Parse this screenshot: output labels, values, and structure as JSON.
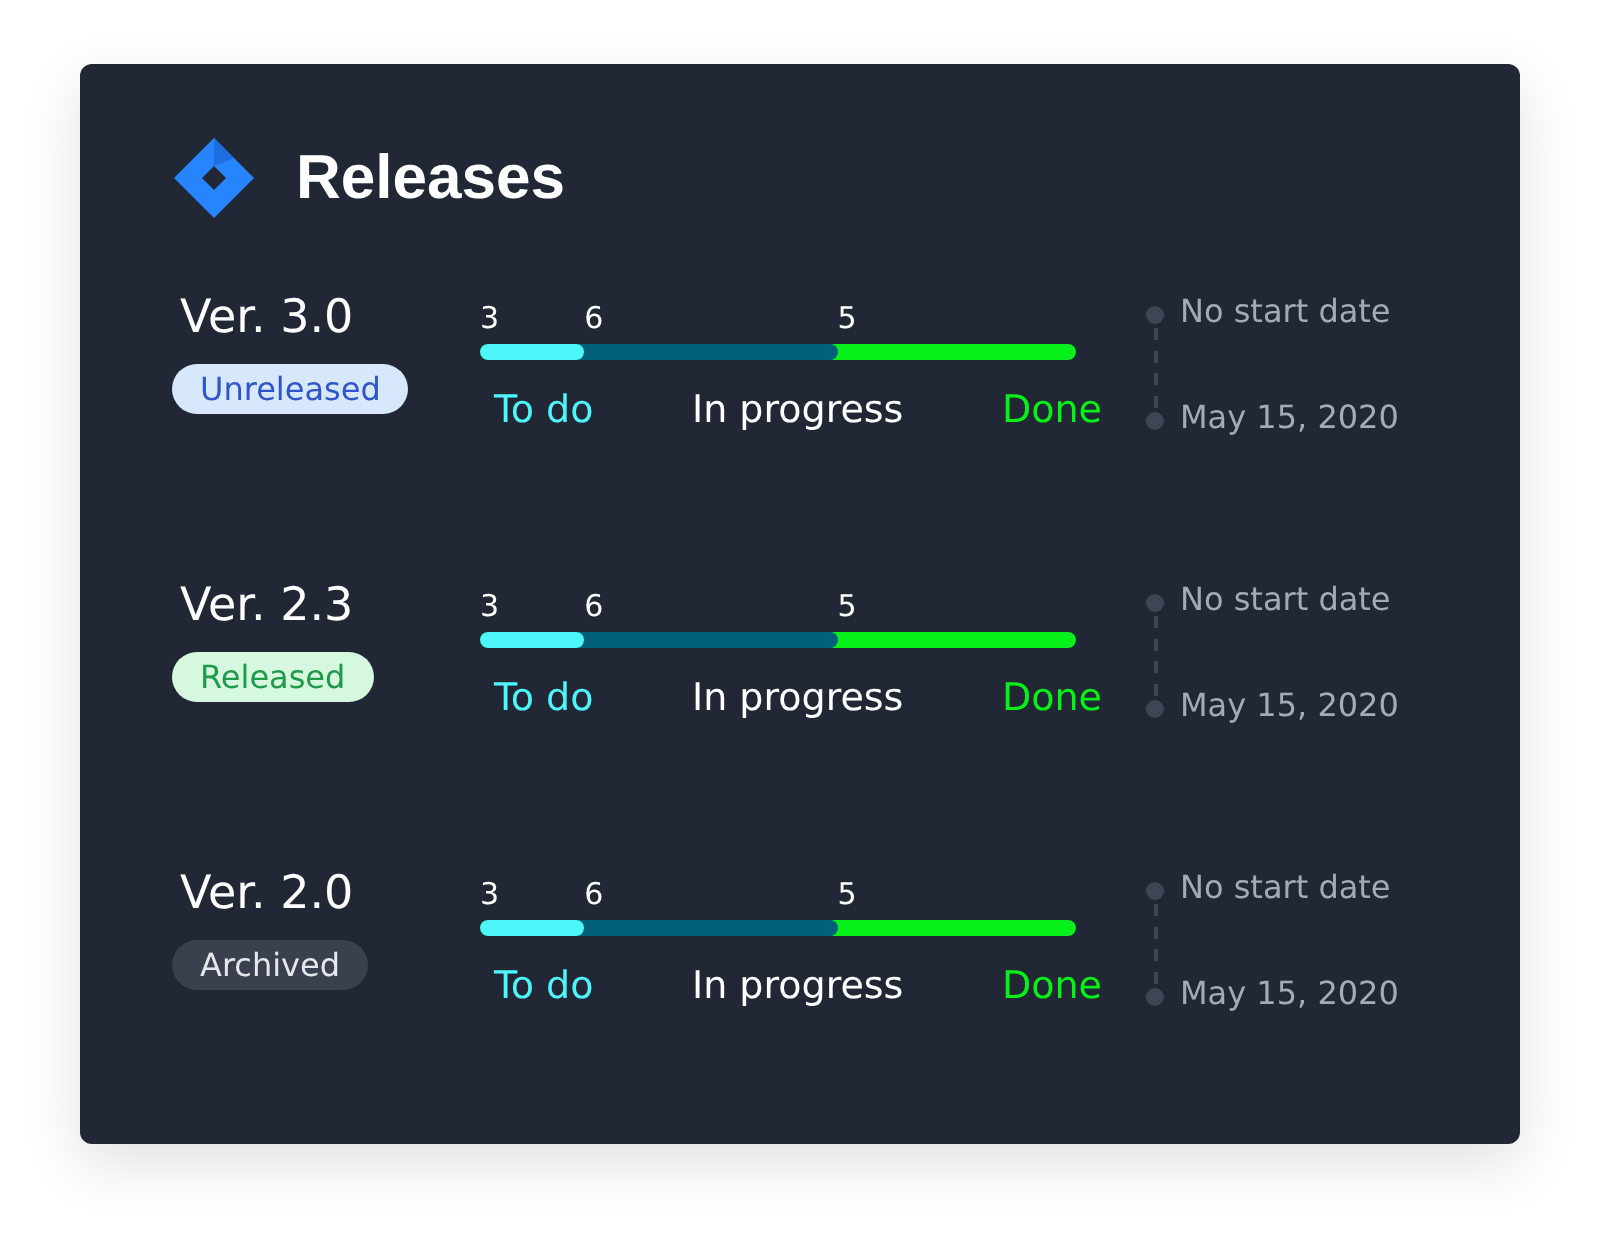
{
  "card": {
    "title": "Releases"
  },
  "releases": [
    {
      "version": "Ver. 3.0",
      "status": {
        "label": "Unreleased",
        "kind": "unreleased"
      },
      "progress": [
        {
          "kind": "todo",
          "count": "3",
          "label": "To do",
          "level": 0.175
        },
        {
          "kind": "progress",
          "count": "6",
          "label": "In progress",
          "level": 0.6
        },
        {
          "kind": "done",
          "count": "5",
          "label": "Done"
        }
      ],
      "start": "No start date",
      "end": "May 15, 2020"
    },
    {
      "version": "Ver. 2.3",
      "status": {
        "label": "Released",
        "kind": "released"
      },
      "progress": [
        {
          "kind": "todo",
          "count": "3",
          "label": "To do",
          "level": 0.175
        },
        {
          "kind": "progress",
          "count": "6",
          "label": "In progress",
          "level": 0.6
        },
        {
          "kind": "done",
          "count": "5",
          "label": "Done"
        }
      ],
      "start": "No start date",
      "end": "May 15, 2020"
    },
    {
      "version": "Ver. 2.0",
      "status": {
        "label": "Archived",
        "kind": "archived"
      },
      "progress": [
        {
          "kind": "todo",
          "count": "3",
          "label": "To do",
          "level": 0.175
        },
        {
          "kind": "progress",
          "count": "6",
          "label": "In progress",
          "level": 0.6
        },
        {
          "kind": "done",
          "count": "5",
          "label": "Done"
        }
      ],
      "start": "No start date",
      "end": "May 15, 2020"
    }
  ]
}
